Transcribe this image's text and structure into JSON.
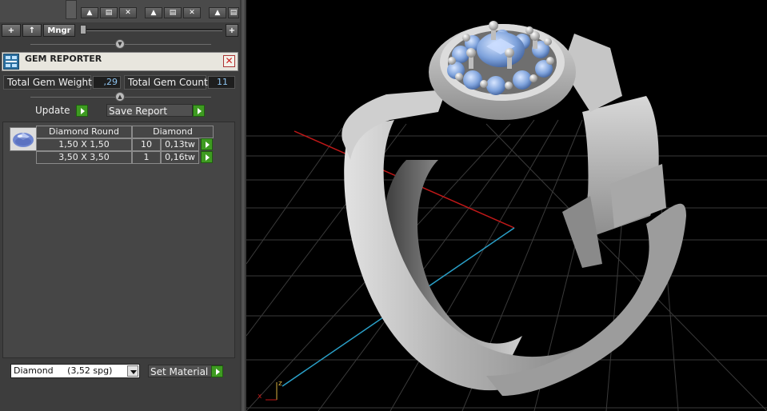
{
  "toolbar": {
    "add_label": "+",
    "up_label": "↑",
    "mngr_label": "Mngr",
    "plus_right_label": "+",
    "glyph_up": "▲",
    "glyph_save": "▤",
    "glyph_close": "✕"
  },
  "gem_reporter": {
    "title": "GEM REPORTER",
    "close_glyph": "✕",
    "total_weight_label": "Total Gem Weight",
    "total_weight_value": ",29",
    "total_count_label": "Total Gem Count",
    "total_count_value": "11",
    "update_label": "Update",
    "save_report_label": "Save Report",
    "table": {
      "header_cut": "Diamond Round",
      "header_material": "Diamond",
      "rows": [
        {
          "size": "1,50 X 1,50",
          "count": "10",
          "weight": "0,13tw"
        },
        {
          "size": "3,50 X 3,50",
          "count": "1",
          "weight": "0,16tw"
        }
      ]
    },
    "material_select_value": "Diamond     (3,52 spg)",
    "set_material_label": "Set Material"
  },
  "viewport": {
    "axis_x_label": "x",
    "axis_z_label": "z",
    "colors": {
      "background": "#000000",
      "grid": "#3a3a3a",
      "axis_x": "#c01818",
      "axis_y": "#2aa0c8",
      "ring_metal": "#b4b4b4",
      "gem": "#8fb2e4"
    }
  }
}
